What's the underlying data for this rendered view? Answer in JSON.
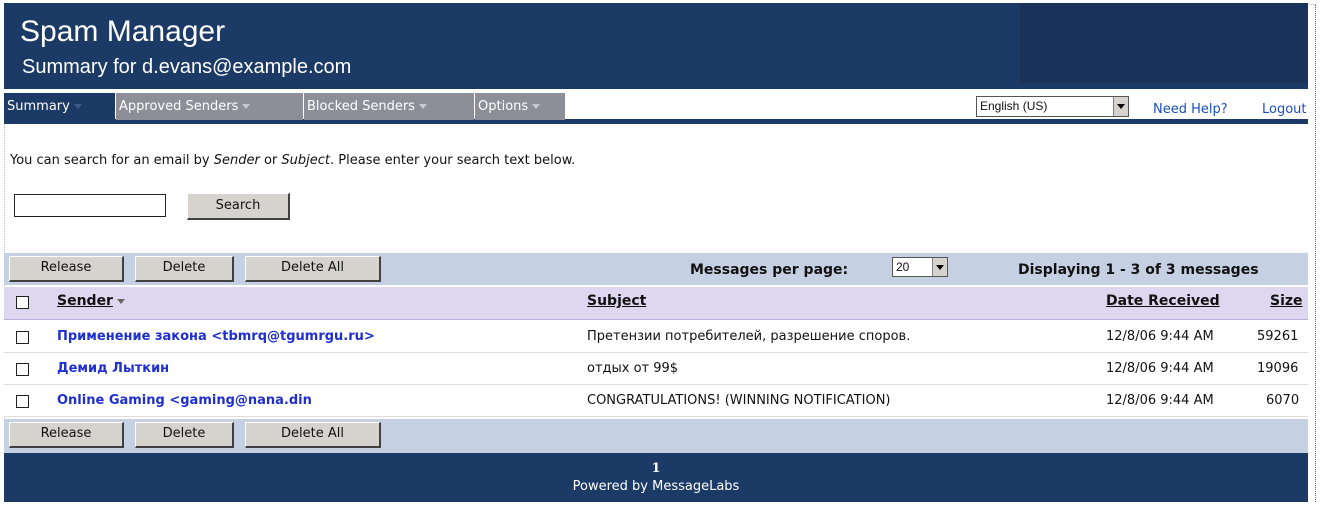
{
  "app": {
    "title": "Spam Manager",
    "subtitle": "Summary for d.evans@example.com"
  },
  "nav": {
    "items": [
      {
        "label": "Summary",
        "active": true
      },
      {
        "label": "Approved Senders",
        "active": false
      },
      {
        "label": "Blocked Senders",
        "active": false
      },
      {
        "label": "Options",
        "active": false
      }
    ],
    "language": "English (US)",
    "help": "Need Help?",
    "logout": "Logout"
  },
  "search": {
    "instructions_prefix": "You can search for an email by ",
    "instructions_sender": "Sender",
    "instructions_or": " or ",
    "instructions_subject": "Subject",
    "instructions_suffix": ". Please enter your search text below.",
    "value": "",
    "button": "Search"
  },
  "toolbar": {
    "release": "Release",
    "delete": "Delete",
    "delete_all": "Delete All",
    "per_page_label": "Messages per page:",
    "per_page_value": "20",
    "displaying": "Displaying 1 - 3 of 3 messages"
  },
  "table": {
    "columns": {
      "sender": "Sender",
      "subject": "Subject",
      "date": "Date Received",
      "size": "Size"
    },
    "rows": [
      {
        "sender": "Применение закона <tbmrq@tgumrgu.ru>",
        "subject": "Претензии потребителей, разрешение споров.",
        "date": "12/8/06 9:44 AM",
        "size": "59261"
      },
      {
        "sender": "Демид Лыткин",
        "subject": "отдых от 99$",
        "date": "12/8/06 9:44 AM",
        "size": "19096"
      },
      {
        "sender": "Online Gaming <gaming@nana.din",
        "subject": "CONGRATULATIONS! (WINNING NOTIFICATION)",
        "date": "12/8/06 9:44 AM",
        "size": "6070"
      }
    ]
  },
  "footer": {
    "page": "1",
    "powered": "Powered by MessageLabs"
  },
  "colors": {
    "header": "#1b3a66",
    "nav_inactive": "#8e8e99",
    "toolbar": "#c5d1e3",
    "table_head": "#ddd8ef",
    "link": "#1a4fbf",
    "sender_link": "#1f2fd0"
  }
}
